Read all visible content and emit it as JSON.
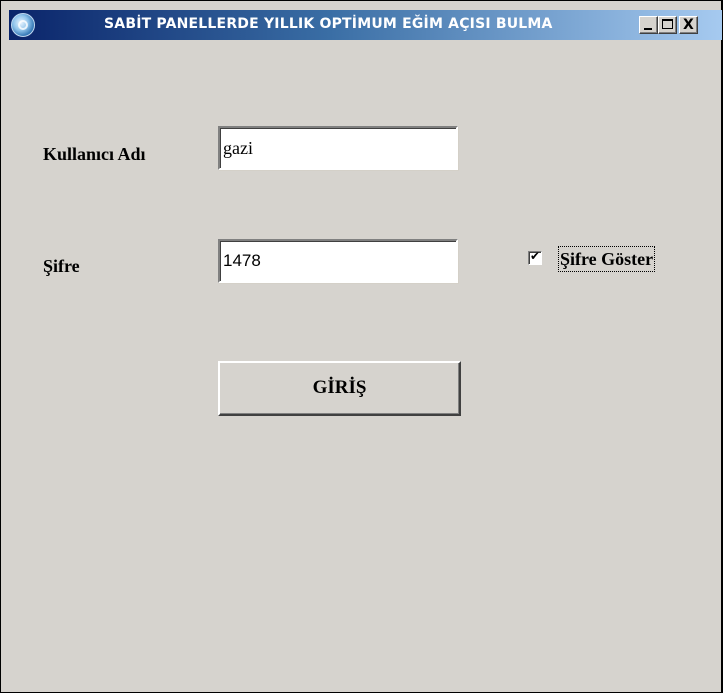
{
  "window": {
    "title": "SABİT PANELLERDE YILLIK OPTİMUM EĞİM AÇISI BULMA",
    "controls": {
      "minimize": "_",
      "maximize": "□",
      "close": "X"
    }
  },
  "form": {
    "username_label": "Kullanıcı Adı",
    "username_value": "gazi",
    "password_label": "Şifre",
    "password_value": "1478",
    "show_password_label": "Şifre Göster",
    "show_password_checked": true,
    "login_button": "GİRİŞ"
  },
  "colors": {
    "window_bg": "#d6d3ce",
    "titlebar_start": "#0a246a",
    "titlebar_end": "#a6caf0"
  },
  "icons": [
    "app-icon",
    "minimize-icon",
    "maximize-icon",
    "close-icon",
    "check-icon"
  ]
}
